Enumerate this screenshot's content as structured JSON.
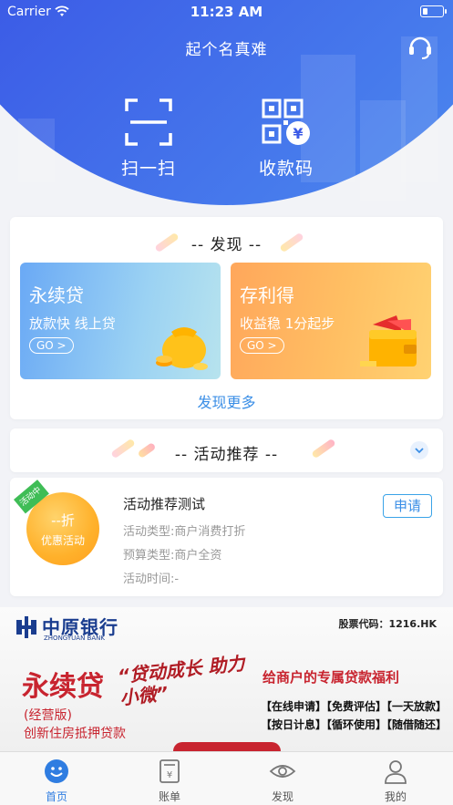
{
  "status_bar": {
    "carrier": "Carrier",
    "time": "11:23 AM"
  },
  "header": {
    "title": "起个名真难"
  },
  "quick_actions": [
    {
      "label": "扫一扫",
      "icon": "scan-icon"
    },
    {
      "label": "收款码",
      "icon": "qr-pay-icon"
    }
  ],
  "discover": {
    "title": "-- 发现 --",
    "cards": [
      {
        "title": "永续贷",
        "subtitle": "放款快 线上贷",
        "go": "GO >",
        "icon": "money-bag-icon"
      },
      {
        "title": "存利得",
        "subtitle": "收益稳 1分起步",
        "go": "GO >",
        "icon": "wallet-icon"
      }
    ],
    "more": "发现更多"
  },
  "activity": {
    "section_title": "-- 活动推荐 --",
    "badge": "活动中",
    "value": "--折",
    "value_label": "优惠活动",
    "title": "活动推荐测试",
    "type_line": "活动类型:商户消费打折",
    "budget_line": "预算类型:商户全资",
    "time_line": "活动时间:-",
    "apply": "申请"
  },
  "banner": {
    "bank_name": "中原银行",
    "bank_en": "ZHONGYUAN BANK",
    "stock": "股票代码：1216.HK",
    "title": "永续贷",
    "slogan": "“贷动成长 助力小微”",
    "right_title": "给商户的专属贷款福利",
    "type": "(经营版)",
    "desc": "创新住房抵押贷款",
    "tags_row1": "【在线申请】【免费评估】【一天放款】",
    "tags_row2": "【按日计息】【循环使用】【随借随还】"
  },
  "tabbar": [
    {
      "label": "首页",
      "icon": "home-smile-icon",
      "active": true
    },
    {
      "label": "账单",
      "icon": "bill-icon",
      "active": false
    },
    {
      "label": "发现",
      "icon": "eye-icon",
      "active": false
    },
    {
      "label": "我的",
      "icon": "user-icon",
      "active": false
    }
  ],
  "colors": {
    "header_blue": "#3b5ae6",
    "accent": "#3a8ee6",
    "orange": "#ffa75b",
    "bank_red": "#c8242f"
  }
}
